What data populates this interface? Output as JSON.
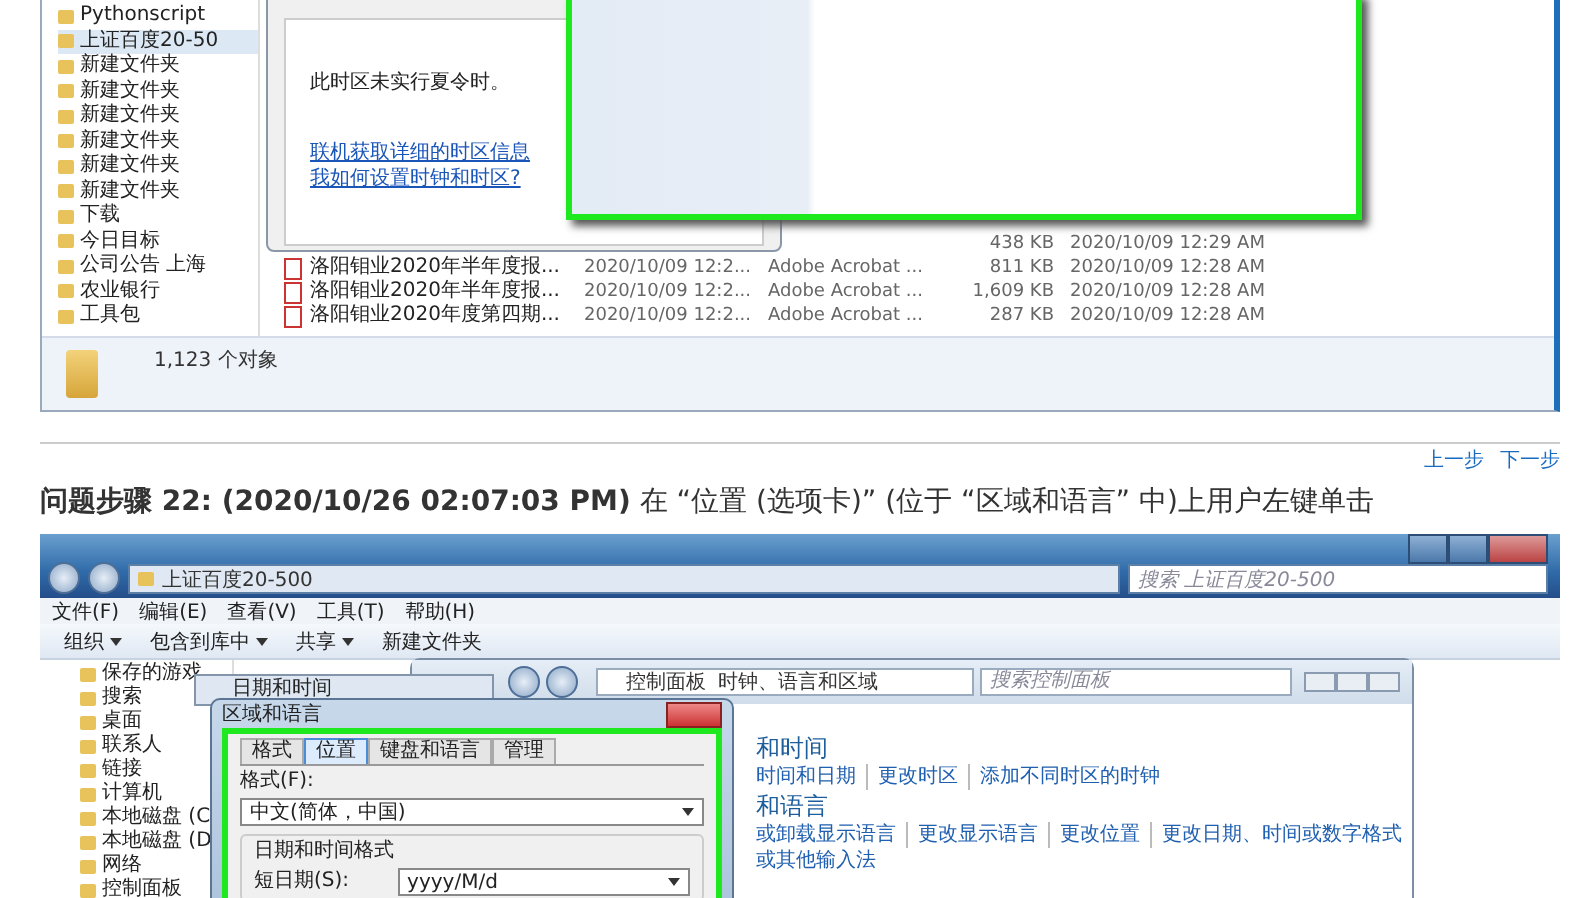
{
  "top_shot": {
    "sidebar_items": [
      {
        "label": "Pythonscript",
        "selected": false
      },
      {
        "label": "上证百度20-50",
        "selected": true
      },
      {
        "label": "新建文件夹",
        "selected": false
      },
      {
        "label": "新建文件夹",
        "selected": false
      },
      {
        "label": "新建文件夹",
        "selected": false
      },
      {
        "label": "新建文件夹",
        "selected": false
      },
      {
        "label": "新建文件夹",
        "selected": false
      },
      {
        "label": "新建文件夹",
        "selected": false
      },
      {
        "label": "下载",
        "selected": false
      },
      {
        "label": "今日目标",
        "selected": false
      },
      {
        "label": "公司公告 上海",
        "selected": false
      },
      {
        "label": "农业银行",
        "selected": false
      },
      {
        "label": "工具包",
        "selected": false
      }
    ],
    "dialog": {
      "note": "此时区未实行夏令时。",
      "links": [
        "联机获取详细的时区信息",
        "我如何设置时钟和时区?"
      ]
    },
    "partial_row": {
      "size": "438 KB",
      "modified": "2020/10/09 12:29 AM"
    },
    "file_rows": [
      {
        "name": "洛阳钼业2020年半年度报...",
        "date": "2020/10/09 12:2...",
        "type": "Adobe Acrobat ...",
        "size": "811 KB",
        "modified": "2020/10/09 12:28 AM"
      },
      {
        "name": "洛阳钼业2020年半年度报...",
        "date": "2020/10/09 12:2...",
        "type": "Adobe Acrobat ...",
        "size": "1,609 KB",
        "modified": "2020/10/09 12:28 AM"
      },
      {
        "name": "洛阳钼业2020年度第四期...",
        "date": "2020/10/09 12:2...",
        "type": "Adobe Acrobat ...",
        "size": "287 KB",
        "modified": "2020/10/09 12:28 AM"
      }
    ],
    "status": "1,123 个对象"
  },
  "nav": [
    "上一步",
    "下一步"
  ],
  "step": "**问题步骤  22: (2020/10/26 02:07:03 PM)** 在 “位置 (选项卡)” (位于 “区域和语言” 中)上用户左键单击",
  "bottom_shot": {
    "address": "上证百度20-500",
    "search_placeholder": "搜索 上证百度20-500",
    "menu": [
      "文件(F)",
      "编辑(E)",
      "查看(V)",
      "工具(T)",
      "帮助(H)"
    ],
    "toolbar": [
      {
        "label": "组织",
        "dropdown": true
      },
      {
        "label": "包含到库中",
        "dropdown": true
      },
      {
        "label": "共享",
        "dropdown": true
      },
      {
        "label": "新建文件夹",
        "dropdown": false
      }
    ],
    "sidebar_items": [
      "保存的游戏",
      "搜索",
      "桌面",
      "联系人",
      "链接",
      "计算机",
      "本地磁盘 (C",
      "本地磁盘 (D",
      "网络",
      "控制面板"
    ],
    "control_panel": {
      "crumbs": [
        "控制面板",
        "时钟、语言和区域"
      ],
      "search_placeholder": "搜索控制面板",
      "sections": [
        {
          "heading": "和时间",
          "links": [
            "时间和日期",
            "更改时区",
            "添加不同时区的时钟"
          ]
        },
        {
          "heading": "和语言",
          "links": [
            "或卸载显示语言",
            "更改显示语言",
            "更改位置",
            "更改日期、时间或数字格式"
          ],
          "extra": "或其他输入法"
        }
      ]
    },
    "datetime_title": "日期和时间",
    "region": {
      "title": "区域和语言",
      "tabs": [
        {
          "label": "格式",
          "selected": false
        },
        {
          "label": "位置",
          "selected": true
        },
        {
          "label": "键盘和语言",
          "selected": false
        },
        {
          "label": "管理",
          "selected": false
        }
      ],
      "format_label": "格式(F):",
      "format_value": "中文(简体，中国)",
      "group_label": "日期和时间格式",
      "short_date_label": "短日期(S):",
      "short_date_value": "yyyy/M/d"
    }
  }
}
